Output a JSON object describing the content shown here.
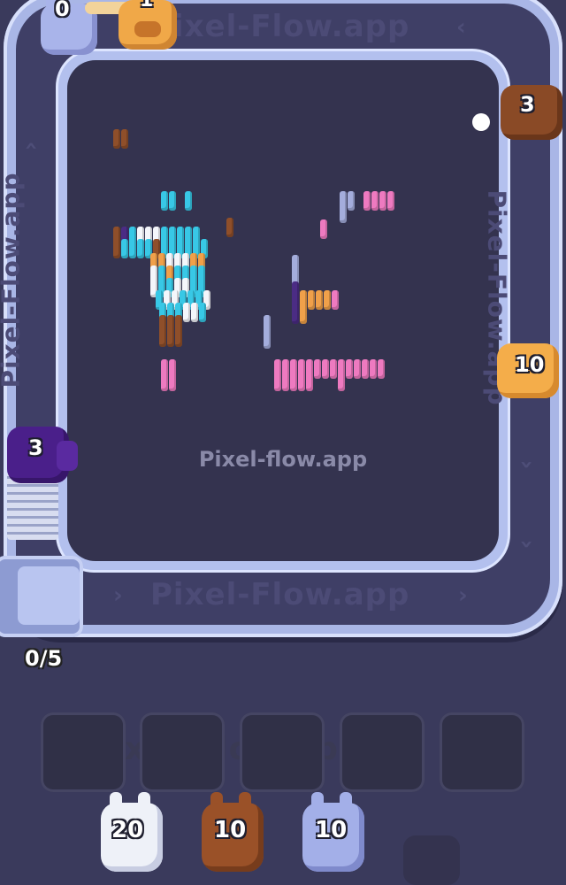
{
  "watermark": {
    "center": "Pixel-flow.app",
    "track_top": "Pixel-Flow.app",
    "track_bottom": "Pixel-Flow.app",
    "track_right": "Pixel-Flow.app",
    "track_left": "Pixel-Flow.app",
    "slots": "Pixel-Flow.app"
  },
  "track_characters": [
    {
      "id": "top-left",
      "value": "0",
      "color": "#a9b4ea"
    },
    {
      "id": "top",
      "value": "1",
      "color": "#f0a848"
    },
    {
      "id": "right-upper",
      "value": "3",
      "color": "#8a4a26"
    },
    {
      "id": "right-middle",
      "value": "10",
      "color": "#f4ad4a"
    },
    {
      "id": "left",
      "value": "3",
      "color": "#4a1f8a"
    }
  ],
  "queue_counter": "0/5",
  "slots": [
    "",
    "",
    "",
    "",
    ""
  ],
  "waiting_characters": [
    {
      "value": "20",
      "color": "#eef1f8"
    },
    {
      "value": "10",
      "color": "#9a5128"
    },
    {
      "value": "10",
      "color": "#a3afe8"
    }
  ],
  "colors": {
    "cyan": "#38c8e6",
    "white": "#f4f6fb",
    "brown": "#8f4f2a",
    "orange": "#f0a04a",
    "pink": "#ee7ac0",
    "lavender": "#a4addc",
    "purple": "#4b2c84"
  }
}
